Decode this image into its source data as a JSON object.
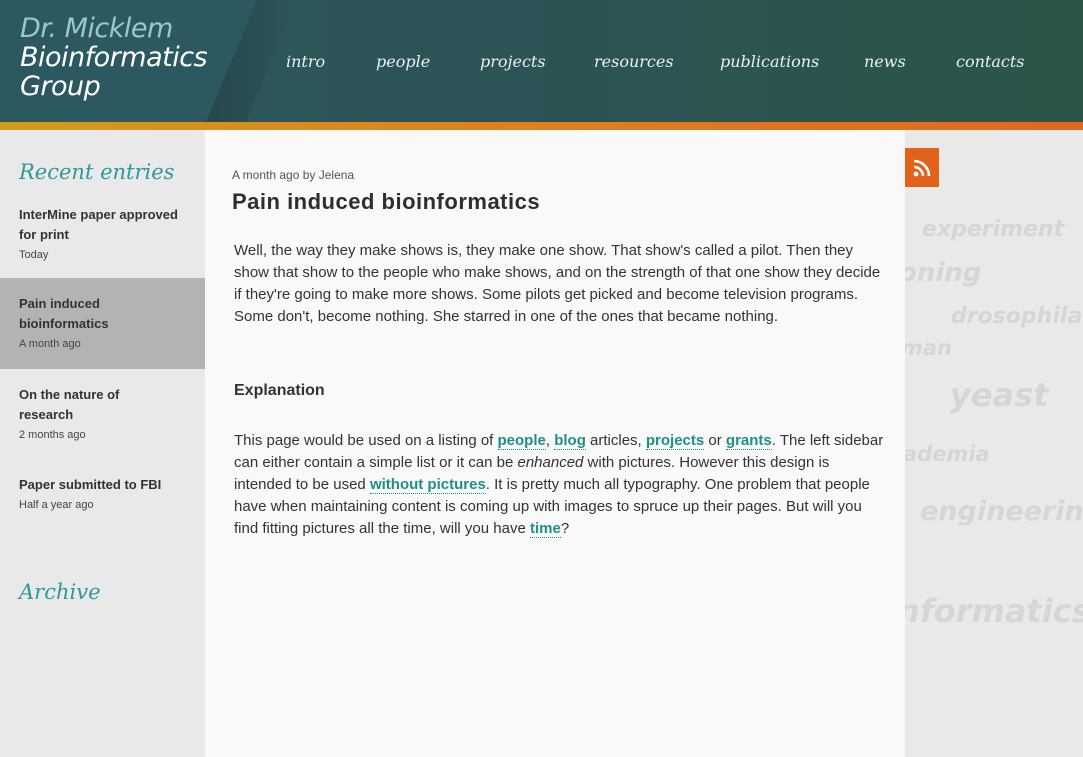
{
  "logo": {
    "line1": "Dr. Micklem",
    "line2": "Bioinformatics",
    "line3": "Group"
  },
  "nav": [
    "intro",
    "people",
    "projects",
    "resources",
    "publications",
    "news",
    "contacts"
  ],
  "sidebar": {
    "recent_heading": "Recent entries",
    "entries": [
      {
        "title": "InterMine paper approved for print",
        "date": "Today"
      },
      {
        "title": "Pain induced bioinformatics",
        "date": "A month ago"
      },
      {
        "title": "On the nature of research",
        "date": "2 months ago"
      },
      {
        "title": "Paper submitted to FBI",
        "date": "Half a year ago"
      }
    ],
    "archive_heading": "Archive"
  },
  "post": {
    "meta": "A month ago by Jelena",
    "title": "Pain induced bioinformatics",
    "body": "Well, the way they make shows is, they make one show. That show's called a pilot. Then they show that show to the people who make shows, and on the strength of that one show they decide if they're going to make more shows. Some pilots get picked and become television programs. Some don't, become nothing. She starred in one of the ones that became nothing.",
    "subheading": "Explanation",
    "exp": {
      "t1": "This page would be used on a listing of ",
      "link_people": "people",
      "t2": ", ",
      "link_blog": "blog",
      "t3": " articles, ",
      "link_projects": "projects",
      "t4": " or ",
      "link_grants": "grants",
      "t5": ". The left sidebar can either contain a simple list or it can be ",
      "em": "enhanced",
      "t6": " with pictures. However this design is intended to be used ",
      "link_without": "without pictures",
      "t7": ". It is pretty much all typography. One problem that people have when maintaining content is coming up with images to spruce up their pages. But will you find fitting pictures all the time, will you have ",
      "link_time": "time",
      "t8": "?"
    }
  },
  "tags": [
    "experiment",
    "oning",
    "drosophila",
    "man",
    "yeast",
    "ademia",
    "engineering",
    "nformatics"
  ],
  "colors": {
    "accent": "#2a9a9a",
    "rss": "#e2621c",
    "header": "#2c5356"
  }
}
